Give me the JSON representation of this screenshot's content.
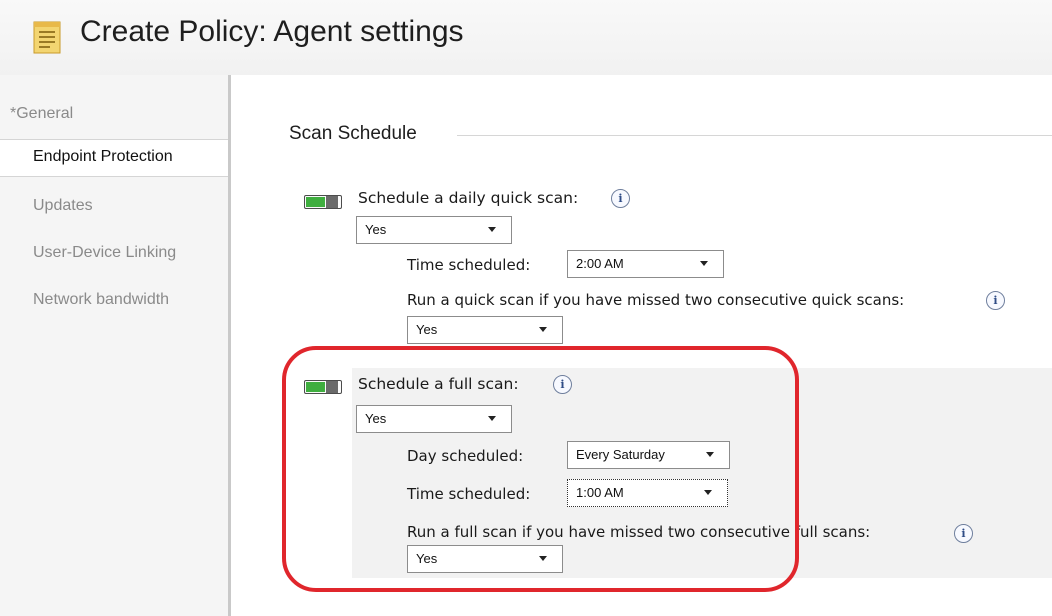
{
  "window": {
    "title": "Create Policy: Agent settings"
  },
  "nav": {
    "items": [
      {
        "label": "*General"
      },
      {
        "label": "Endpoint Protection"
      },
      {
        "label": "Updates"
      },
      {
        "label": "User-Device Linking"
      },
      {
        "label": "Network bandwidth"
      }
    ],
    "selected": "Endpoint Protection"
  },
  "scan_schedule": {
    "header": "Scan Schedule",
    "daily_quick": {
      "label": "Schedule a daily quick scan:",
      "enabled": true,
      "value": "Yes",
      "time_label": "Time scheduled:",
      "time_value": "2:00 AM",
      "missed_label": "Run a quick scan if you have missed two consecutive quick scans:",
      "missed_value": "Yes"
    },
    "full": {
      "label": "Schedule a full scan:",
      "enabled": true,
      "value": "Yes",
      "day_label": "Day scheduled:",
      "day_value": "Every Saturday",
      "time_label": "Time scheduled:",
      "time_value": "1:00 AM",
      "missed_label": "Run a full scan if you have missed two consecutive full scans:",
      "missed_value": "Yes"
    }
  },
  "icons": {
    "title": "policy-document-icon",
    "info": "info-icon"
  },
  "colors": {
    "highlight": "#e0262c",
    "toggle_on": "#3fae3f",
    "info": "#2f4c86"
  },
  "info_glyph": "i"
}
